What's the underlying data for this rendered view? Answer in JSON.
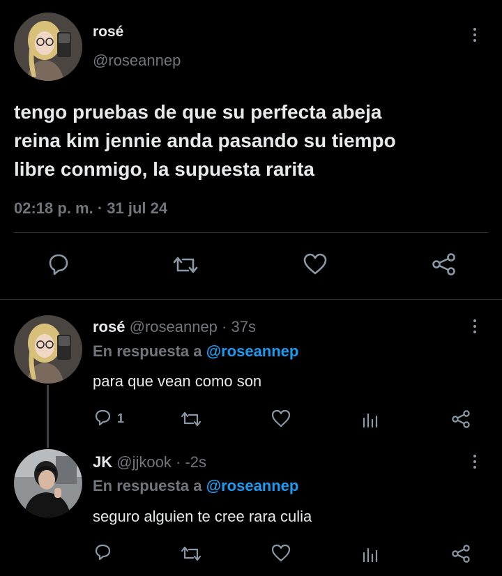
{
  "main_tweet": {
    "display_name": "rosé",
    "handle": "@roseannep",
    "text_lines": [
      "tengo pruebas de que su perfecta abeja",
      "reina kim jennie anda pasando su tiempo",
      "libre conmigo, la supuesta rarita"
    ],
    "timestamp": "02:18 p. m. · 31 jul 24"
  },
  "replies": [
    {
      "display_name": "rosé",
      "handle_time": "@roseannep · 37s",
      "reply_prefix": "En respuesta a ",
      "reply_to": "@roseannep",
      "text": "para que vean como son",
      "reply_count": "1"
    },
    {
      "display_name": "JK",
      "handle_time": "@jjkook · -2s",
      "reply_prefix": "En respuesta a ",
      "reply_to": "@roseannep",
      "text": "seguro alguien te cree rara culia",
      "reply_count": ""
    }
  ],
  "icons": {
    "reply": "reply-icon",
    "retweet": "retweet-icon",
    "like": "like-icon",
    "share": "share-icon",
    "views": "views-icon",
    "more": "more-vertical-icon"
  },
  "colors": {
    "background": "#000000",
    "text": "#e7e9ea",
    "muted": "#71767b",
    "link": "#1d9bf0",
    "divider": "#2f3336"
  }
}
